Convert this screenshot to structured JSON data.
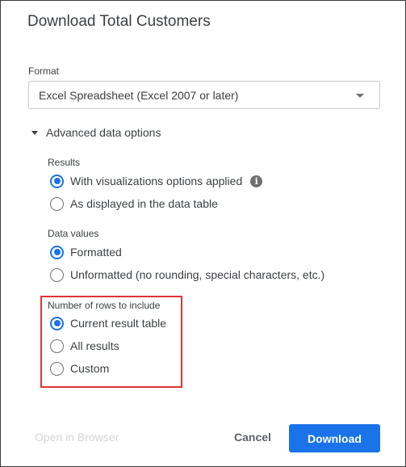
{
  "dialog": {
    "title": "Download Total Customers"
  },
  "format": {
    "label": "Format",
    "selected": "Excel Spreadsheet (Excel 2007 or later)"
  },
  "advanced": {
    "toggle_label": "Advanced data options",
    "results": {
      "label": "Results",
      "options": [
        {
          "label": "With visualizations options applied",
          "checked": true,
          "info_icon": "info-icon"
        },
        {
          "label": "As displayed in the data table",
          "checked": false
        }
      ]
    },
    "data_values": {
      "label": "Data values",
      "options": [
        {
          "label": "Formatted",
          "checked": true
        },
        {
          "label": "Unformatted (no rounding, special characters, etc.)",
          "checked": false
        }
      ]
    },
    "rows": {
      "label": "Number of rows to include",
      "options": [
        {
          "label": "Current result table",
          "checked": true
        },
        {
          "label": "All results",
          "checked": false
        },
        {
          "label": "Custom",
          "checked": false
        }
      ]
    }
  },
  "footer": {
    "open_in_browser": "Open in Browser",
    "cancel": "Cancel",
    "download": "Download"
  },
  "colors": {
    "accent": "#1a73e8",
    "highlight": "#e03434"
  }
}
